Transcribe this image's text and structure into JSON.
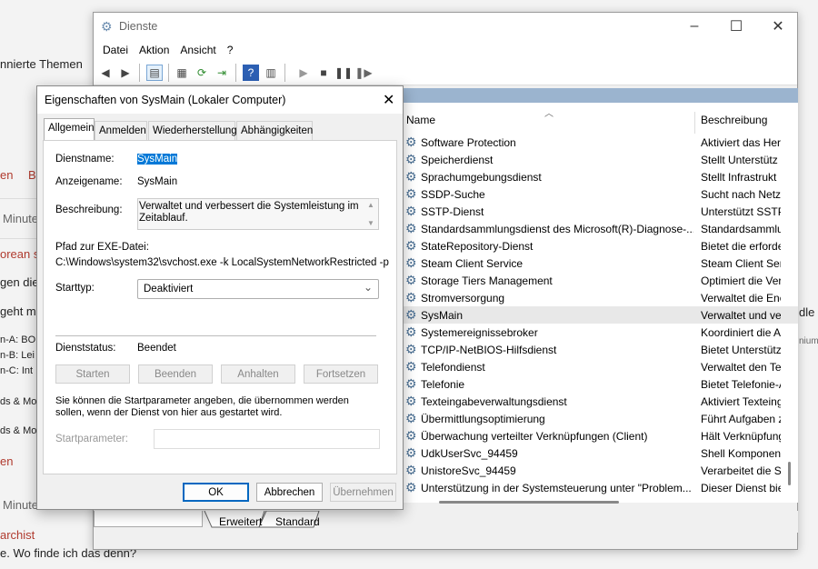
{
  "background": {
    "lines": [
      "nnierte Themen",
      "en",
      "B",
      "Minute",
      "orean s",
      "gen die",
      "geht m",
      "n-A: BO",
      "n-B: Lei",
      "n-C: Int",
      "ds & Mo",
      "ds & Mo",
      "en",
      "Minute",
      "archist",
      "e. Wo finde ich das denn?",
      "dle",
      "nium"
    ]
  },
  "services_window": {
    "title": "Dienste",
    "menu": [
      "Datei",
      "Aktion",
      "Ansicht",
      "?"
    ],
    "columns": {
      "name": "Name",
      "description": "Beschreibung"
    },
    "rows": [
      {
        "name": "Software Protection",
        "desc": "Aktiviert das Her"
      },
      {
        "name": "Speicherdienst",
        "desc": "Stellt Unterstütz"
      },
      {
        "name": "Sprachumgebungsdienst",
        "desc": "Stellt Infrastrukt"
      },
      {
        "name": "SSDP-Suche",
        "desc": "Sucht nach Netzw"
      },
      {
        "name": "SSTP-Dienst",
        "desc": "Unterstützt SSTP"
      },
      {
        "name": "Standardsammlungsdienst des Microsoft(R)-Diagnose-...",
        "desc": "Standardsammlu"
      },
      {
        "name": "StateRepository-Dienst",
        "desc": "Bietet die erforde"
      },
      {
        "name": "Steam Client Service",
        "desc": "Steam Client Serv"
      },
      {
        "name": "Storage Tiers Management",
        "desc": "Optimiert die Ver"
      },
      {
        "name": "Stromversorgung",
        "desc": "Verwaltet die Ene"
      },
      {
        "name": "SysMain",
        "desc": "Verwaltet und ve"
      },
      {
        "name": "Systemereignissebroker",
        "desc": "Koordiniert die A"
      },
      {
        "name": "TCP/IP-NetBIOS-Hilfsdienst",
        "desc": "Bietet Unterstütz"
      },
      {
        "name": "Telefondienst",
        "desc": "Verwaltet den Tel"
      },
      {
        "name": "Telefonie",
        "desc": "Bietet Telefonie-A"
      },
      {
        "name": "Texteingabeverwaltungsdienst",
        "desc": "Aktiviert Texteing"
      },
      {
        "name": "Übermittlungsoptimierung",
        "desc": "Führt Aufgaben z"
      },
      {
        "name": "Überwachung verteilter Verknüpfungen (Client)",
        "desc": "Hält Verknüpfung"
      },
      {
        "name": "UdkUserSvc_94459",
        "desc": "Shell Komponent"
      },
      {
        "name": "UnistoreSvc_94459",
        "desc": "Verarbeitet die Sp"
      },
      {
        "name": "Unterstützung in der Systemsteuerung unter \"Problem...",
        "desc": "Dieser Dienst bie"
      }
    ],
    "tabs": [
      "Erweitert",
      "Standard"
    ]
  },
  "dialog": {
    "title": "Eigenschaften von SysMain (Lokaler Computer)",
    "tabs": [
      "Allgemein",
      "Anmelden",
      "Wiederherstellung",
      "Abhängigkeiten"
    ],
    "dienstname_label": "Dienstname:",
    "dienstname_value": "SysMain",
    "anzeigename_label": "Anzeigename:",
    "anzeigename_value": "SysMain",
    "beschreibung_label": "Beschreibung:",
    "beschreibung_value": "Verwaltet und verbessert die Systemleistung im Zeitablauf.",
    "pfad_label": "Pfad zur EXE-Datei:",
    "pfad_value": "C:\\Windows\\system32\\svchost.exe -k LocalSystemNetworkRestricted -p",
    "starttyp_label": "Starttyp:",
    "starttyp_value": "Deaktiviert",
    "dienststatus_label": "Dienststatus:",
    "dienststatus_value": "Beendet",
    "buttons": {
      "starten": "Starten",
      "beenden": "Beenden",
      "anhalten": "Anhalten",
      "fortsetzen": "Fortsetzen"
    },
    "hint": "Sie können die Startparameter angeben, die übernommen werden sollen, wenn der Dienst von hier aus gestartet wird.",
    "startparameter_label": "Startparameter:",
    "ok": "OK",
    "abbrechen": "Abbrechen",
    "uebernehmen": "Übernehmen"
  }
}
